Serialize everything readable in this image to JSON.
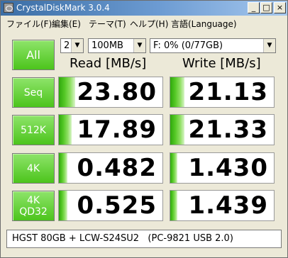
{
  "window": {
    "title": "CrystalDiskMark 3.0.4",
    "controls": {
      "minimize": "_",
      "maximize": "□",
      "close": "×"
    }
  },
  "menu": [
    "ファイル(F)",
    "編集(E)",
    "テーマ(T)",
    "ヘルプ(H)",
    "言語(Language)"
  ],
  "controls": {
    "all_label": "All",
    "test_count": "2",
    "test_size": "100MB",
    "drive": "F: 0% (0/77GB)",
    "dropdown_arrow": "▼"
  },
  "headers": {
    "read": "Read [MB/s]",
    "write": "Write [MB/s]"
  },
  "rows": [
    {
      "label": "Seq",
      "read": "23.80",
      "write": "21.13",
      "read_fill": 0.16,
      "write_fill": 0.14
    },
    {
      "label": "512K",
      "read": "17.89",
      "write": "21.33",
      "read_fill": 0.12,
      "write_fill": 0.14
    },
    {
      "label": "4K",
      "read": "0.482",
      "write": "1.430",
      "read_fill": 0.08,
      "write_fill": 0.07
    },
    {
      "label": "4K",
      "label2": "QD32",
      "read": "0.525",
      "write": "1.439",
      "read_fill": 0.08,
      "write_fill": 0.07
    }
  ],
  "comment": "HGST 80GB + LCW-S24SU2   (PC-9821 USB 2.0)",
  "colors": {
    "accent_green": "#4cc41c",
    "titlebar_blue": "#3b6ea5"
  }
}
